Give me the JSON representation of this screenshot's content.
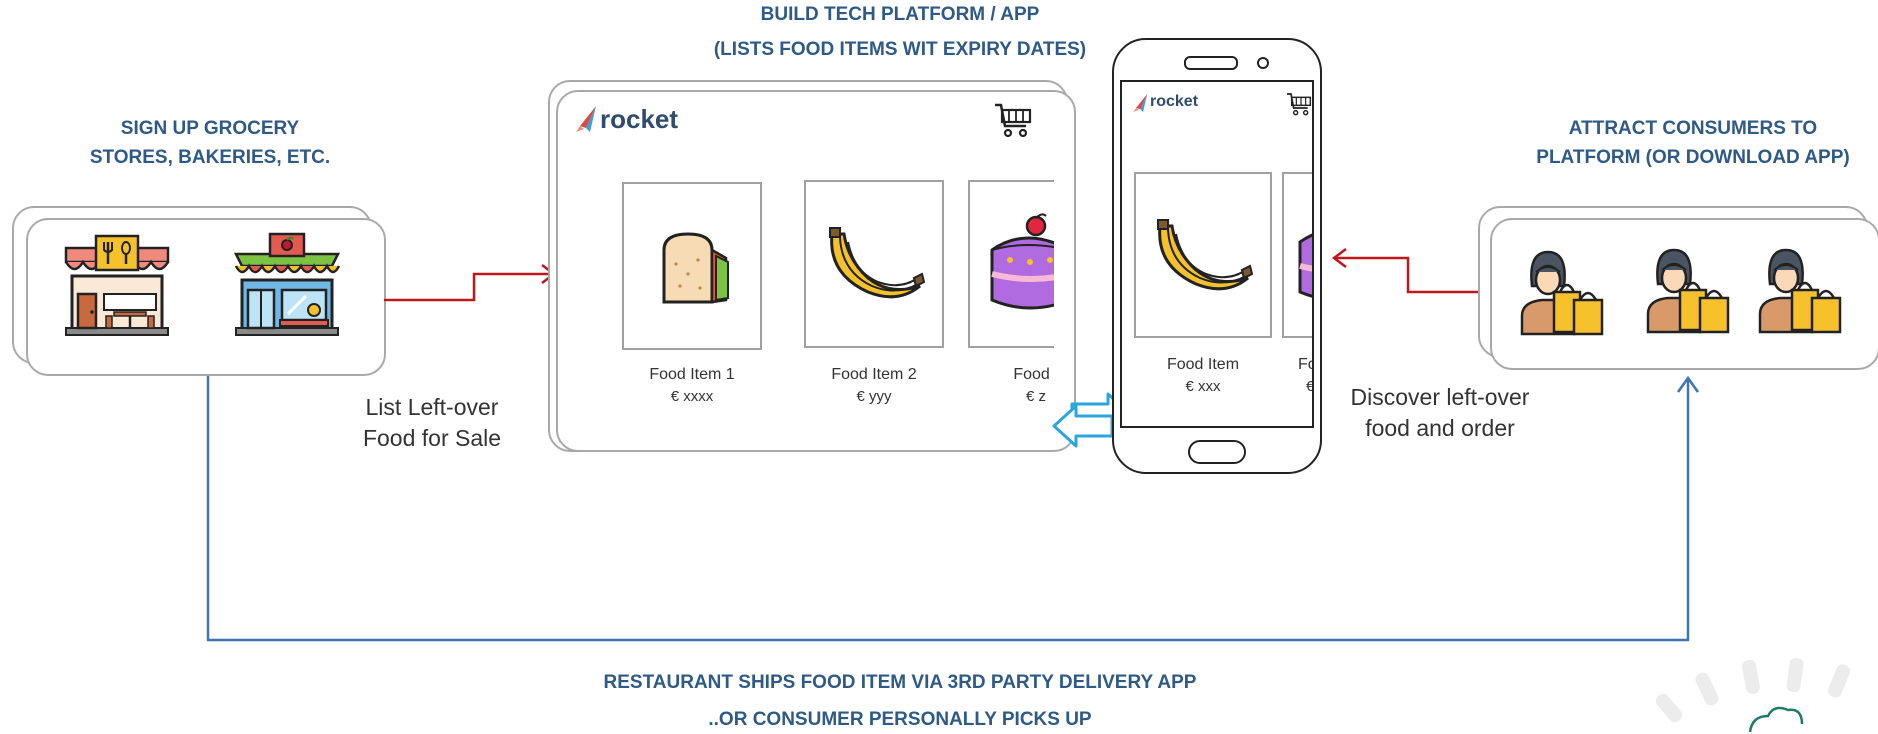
{
  "headings": {
    "build_platform": [
      "BUILD TECH PLATFORM / APP",
      "(LISTS FOOD ITEMS WIT EXPIRY DATES)"
    ],
    "sign_up": [
      "SIGN UP GROCERY",
      "STORES, BAKERIES, ETC."
    ],
    "attract": [
      "ATTRACT CONSUMERS TO",
      "PLATFORM (OR DOWNLOAD APP)"
    ],
    "ships": [
      "RESTAURANT SHIPS FOOD ITEM VIA 3RD PARTY DELIVERY APP",
      "..OR CONSUMER PERSONALLY PICKS UP"
    ]
  },
  "captions": {
    "list_food": [
      "List Left-over",
      "Food for Sale"
    ],
    "discover": [
      "Discover left-over",
      "food and order"
    ]
  },
  "platform": {
    "logo": "rocket",
    "items": [
      {
        "name": "Food Item 1",
        "price": "€ xxxx"
      },
      {
        "name": "Food Item 2",
        "price": "€ yyy"
      },
      {
        "name": "Food I",
        "price": "€ z"
      }
    ]
  },
  "phone": {
    "logo": "rocket",
    "items": [
      {
        "name": "Food Item",
        "price": "€ xxx"
      },
      {
        "name": "Fo",
        "price": "€"
      }
    ]
  },
  "colors": {
    "heading": "#2e5a85",
    "red_arrow": "#c0171c",
    "blue_line": "#3f74b3",
    "cyan_arrow": "#2aa6df"
  }
}
